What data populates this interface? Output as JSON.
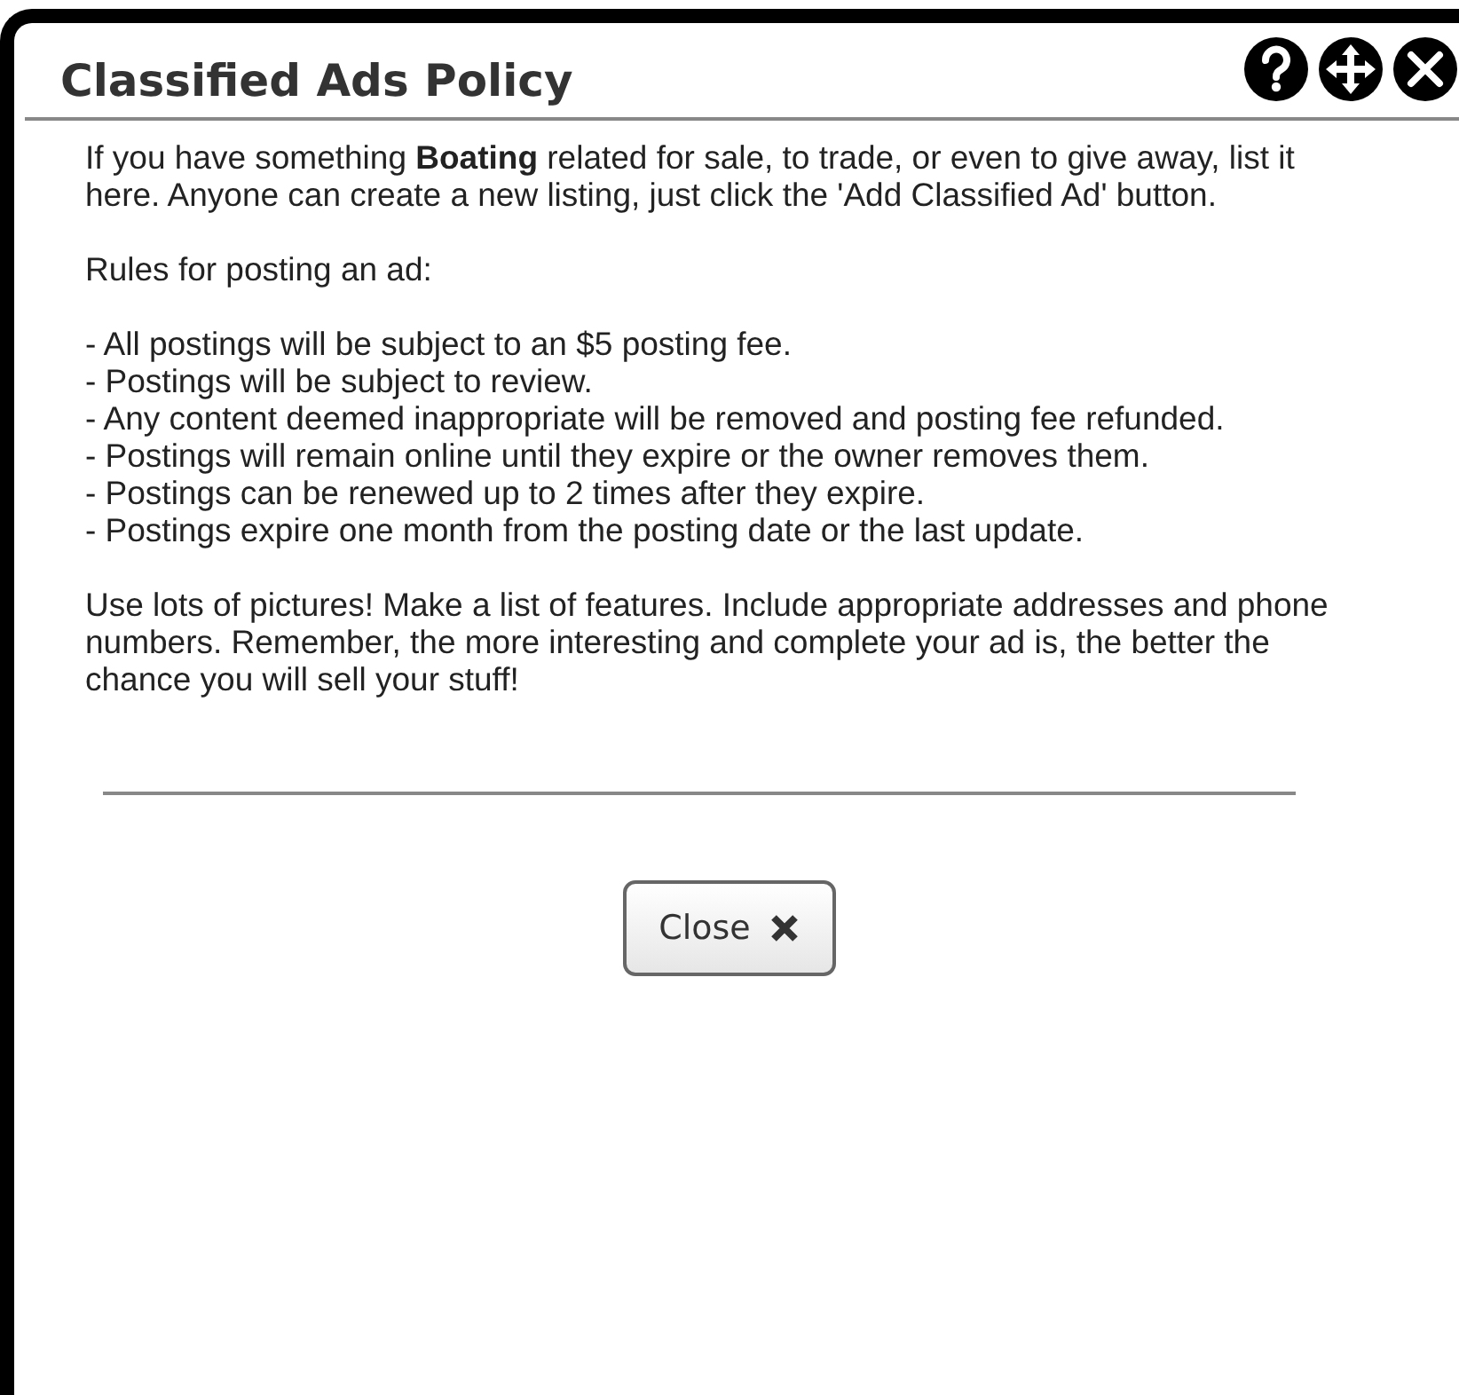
{
  "dialog": {
    "title": "Classified Ads Policy",
    "header_buttons": [
      {
        "kind": "help"
      },
      {
        "kind": "move"
      },
      {
        "kind": "close"
      }
    ],
    "intro": "If you have something **Boating** related for sale, to trade, or even to give away, list it here.  Anyone can create a new listing, just click the 'Add Classified Ad' button.",
    "rules_heading": "Rules for posting an ad:",
    "rules": [
      "-  All postings will be subject to an $5 posting fee.",
      "-  Postings will be subject to review.",
      "-  Any content deemed inappropriate will be removed and posting fee refunded.",
      "-  Postings will remain online until they expire or the owner removes them.",
      "-  Postings can be renewed up to 2 times after they expire.",
      "-  Postings expire one month from the posting date or the last update."
    ],
    "advice": "Use lots of pictures!  Make a list of features. Include appropriate addresses and phone numbers.  Remember, the more interesting and complete your ad is, the better the chance you will sell your stuff!",
    "close_button": {
      "label": "Close"
    }
  }
}
